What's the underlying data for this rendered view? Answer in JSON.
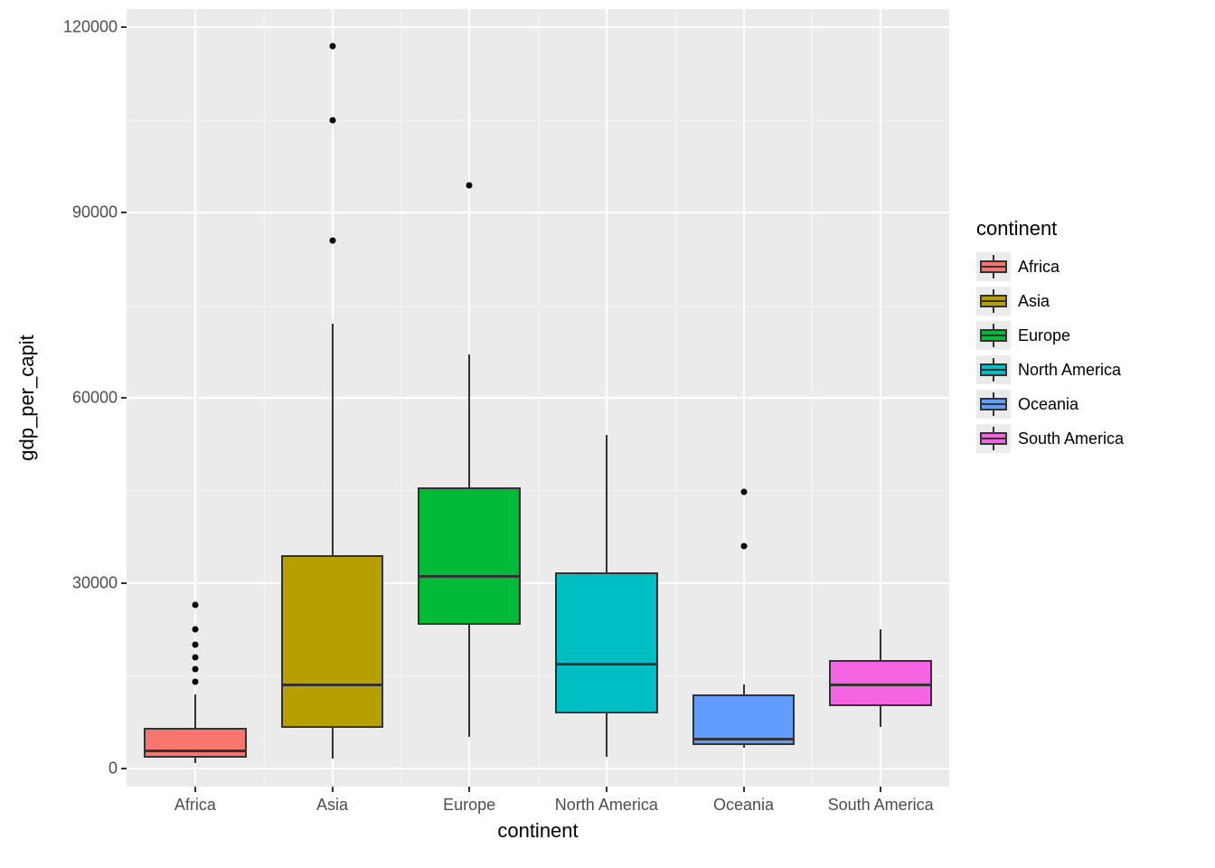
{
  "chart_data": {
    "type": "boxplot",
    "xlabel": "continent",
    "ylabel": "gdp_per_capit",
    "ylim": [
      -3000,
      123000
    ],
    "y_ticks": [
      0,
      30000,
      60000,
      90000,
      120000
    ],
    "categories": [
      "Africa",
      "Asia",
      "Europe",
      "North America",
      "Oceania",
      "South America"
    ],
    "colors": {
      "Africa": "#F8766D",
      "Asia": "#B79F00",
      "Europe": "#00BA38",
      "North America": "#00BFC4",
      "Oceania": "#619CFF",
      "South America": "#F564E3"
    },
    "series": [
      {
        "name": "Africa",
        "min": 800,
        "q1": 1700,
        "median": 2800,
        "q3": 6500,
        "max": 12000,
        "outliers": [
          14000,
          16000,
          18000,
          20000,
          22500,
          26500
        ]
      },
      {
        "name": "Asia",
        "min": 1500,
        "q1": 6500,
        "median": 13500,
        "q3": 34500,
        "max": 72000,
        "outliers": [
          85500,
          105000,
          117000
        ]
      },
      {
        "name": "Europe",
        "min": 5000,
        "q1": 23200,
        "median": 31000,
        "q3": 45500,
        "max": 67000,
        "outliers": [
          94500
        ]
      },
      {
        "name": "North America",
        "min": 1800,
        "q1": 8800,
        "median": 16800,
        "q3": 31700,
        "max": 54000,
        "outliers": []
      },
      {
        "name": "Oceania",
        "min": 3300,
        "q1": 3800,
        "median": 4700,
        "q3": 12000,
        "max": 13500,
        "outliers": [
          36000,
          44800
        ]
      },
      {
        "name": "South America",
        "min": 6700,
        "q1": 10000,
        "median": 13500,
        "q3": 17500,
        "max": 22500,
        "outliers": []
      }
    ],
    "legend_title": "continent"
  }
}
